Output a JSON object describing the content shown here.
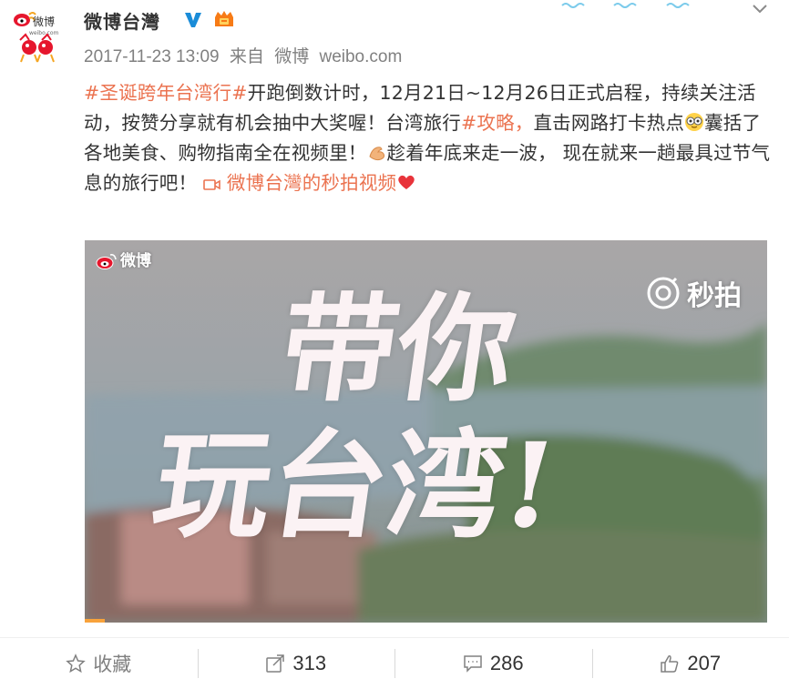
{
  "header": {
    "username": "微博台灣",
    "avatar_label": "微博",
    "avatar_sublabel": "weibo.com",
    "verified_icon": "verified-v-icon",
    "member_icon": "vip-crown-icon"
  },
  "meta": {
    "timestamp": "2017-11-23 13:09",
    "source_prefix": "来自",
    "source": "微博",
    "domain": "weibo.com"
  },
  "post": {
    "hashtag1": "#圣诞跨年台湾行#",
    "text1": "开跑倒数计时，12月21日~12月26日正式启程，持续关注活动，按赞分享就有机会抽中大奖喔！台湾旅行",
    "hashtag2": "#攻略，",
    "text2": "直击网路打卡热点",
    "text3": "囊括了各地美食、购物指南全在视频里！",
    "text4": "趁着年底来走一波， 现在就来一趟最具过节气息的旅行吧！",
    "video_link": "微博台灣的秒拍视频"
  },
  "video": {
    "watermark": "微博",
    "miaopai": "秒拍",
    "title_line1": "带你",
    "title_line2": "玩台湾!",
    "progress": 0.03
  },
  "toolbar": {
    "collect_label": "收藏",
    "repost_count": "313",
    "comment_count": "286",
    "like_count": "207"
  },
  "colors": {
    "link": "#eb7350",
    "muted": "#808080",
    "progress": "#f8a23b"
  }
}
